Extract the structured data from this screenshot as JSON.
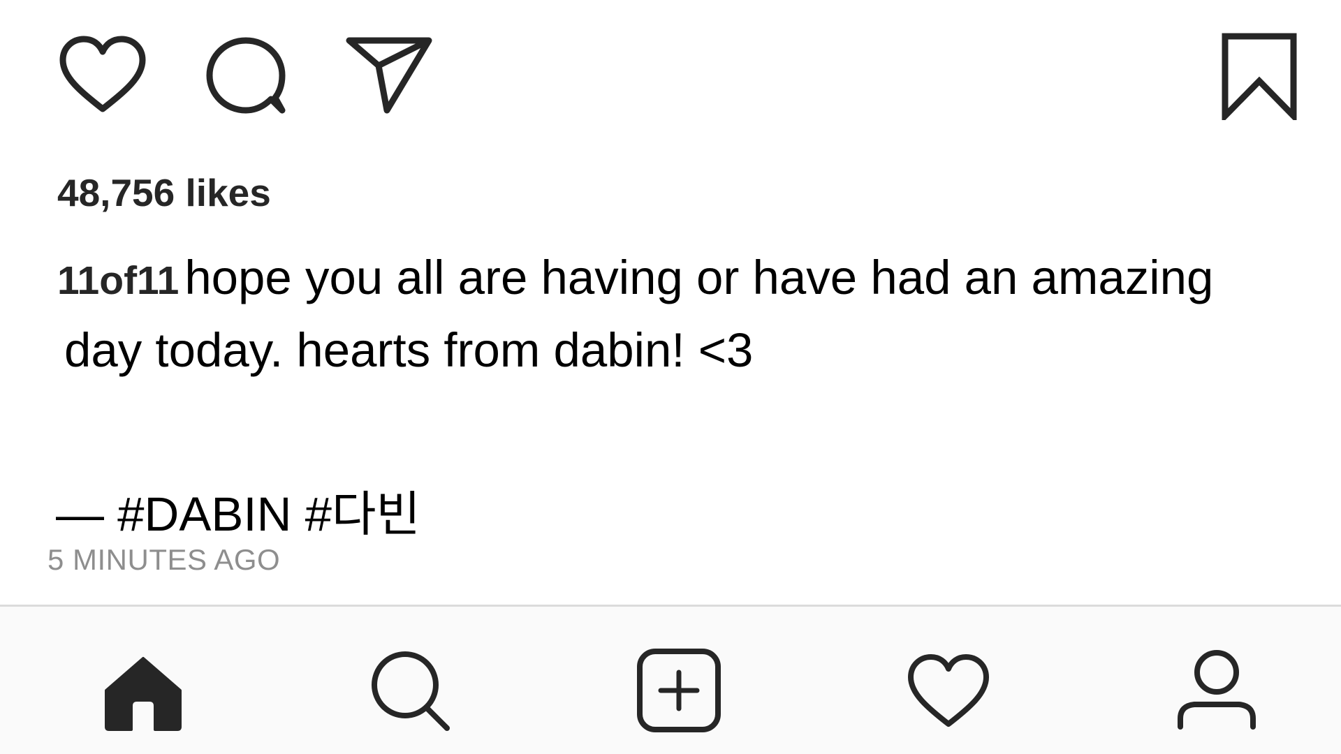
{
  "actions": {
    "like_icon": "heart-outline-icon",
    "comment_icon": "comment-bubble-icon",
    "share_icon": "paper-plane-icon",
    "bookmark_icon": "bookmark-outline-icon"
  },
  "post": {
    "likes_text": "48,756 likes",
    "username": "11of11",
    "caption_line1": "hope you all are having or have had an amazing",
    "caption_line2": "day today. hearts from dabin! <3",
    "hashtags_text": "— #DABIN #다빈",
    "timestamp": "5 MINUTES AGO"
  },
  "bottom_nav": {
    "items": [
      {
        "icon": "home-filled-icon"
      },
      {
        "icon": "search-icon"
      },
      {
        "icon": "add-post-icon"
      },
      {
        "icon": "heart-outline-icon"
      },
      {
        "icon": "profile-icon"
      }
    ],
    "background": "#fafafa",
    "border_color": "#dbdbdb"
  },
  "colors": {
    "text_primary": "#000000",
    "text_bold": "#262626",
    "text_muted": "#8e8e8e",
    "icon": "#262626"
  }
}
